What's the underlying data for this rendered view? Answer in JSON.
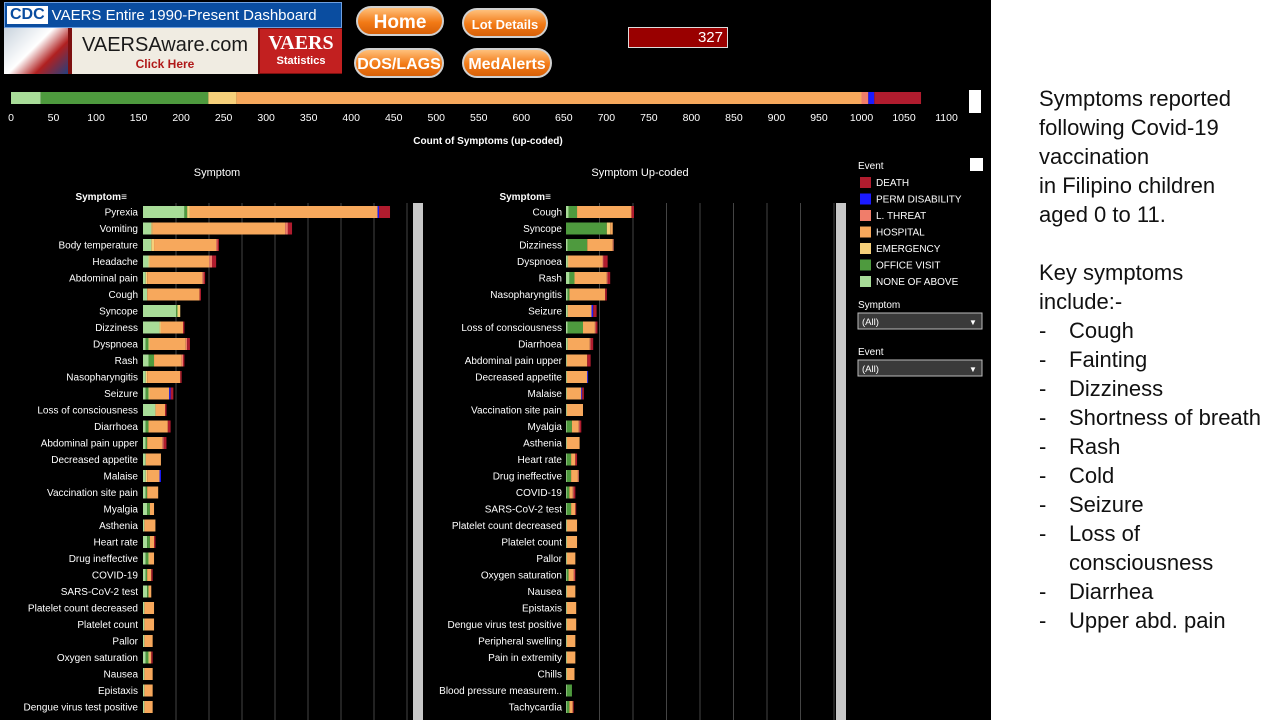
{
  "header": {
    "cdc_logo": "CDC",
    "title": "VAERS Entire 1990-Present Dashboard",
    "aware_link": "VAERSAware.com",
    "aware_click": "Click Here",
    "vaers_logo": "VAERS",
    "vaers_stats": "Statistics",
    "buttons": {
      "home": "Home",
      "lot_details": "Lot Details",
      "dos_lags": "DOS/LAGS",
      "medalerts": "MedAlerts"
    },
    "counter": "327"
  },
  "colors": {
    "DEATH": "#b01c2e",
    "PERM DISABILITY": "#1a1aff",
    "L. THREAT": "#f07d6a",
    "HOSPITAL": "#f7a85c",
    "EMERGENCY": "#f6d07a",
    "OFFICE VISIT": "#4e9a3e",
    "NONE OF ABOVE": "#a8dc98"
  },
  "chart_data": [
    {
      "type": "bar",
      "orientation": "horizontal-stacked",
      "xlabel": "Count of Symptoms (up-coded)",
      "x_ticks": [
        0,
        50,
        100,
        150,
        200,
        250,
        300,
        350,
        400,
        450,
        500,
        550,
        600,
        650,
        700,
        750,
        800,
        850,
        900,
        950,
        1000,
        1050,
        1100
      ],
      "series": [
        {
          "name": "NONE OF ABOVE",
          "values": [
            35
          ]
        },
        {
          "name": "OFFICE VISIT",
          "values": [
            197
          ]
        },
        {
          "name": "EMERGENCY",
          "values": [
            33
          ]
        },
        {
          "name": "HOSPITAL",
          "values": [
            735
          ]
        },
        {
          "name": "L. THREAT",
          "values": 8
        },
        {
          "name": "PERM DISABILITY",
          "values": [
            7
          ]
        },
        {
          "name": "DEATH",
          "values": [
            55
          ]
        }
      ]
    },
    {
      "type": "bar",
      "orientation": "horizontal-stacked",
      "title": "Symptom",
      "ylabel": "Symptom",
      "categories": [
        "Pyrexia",
        "Vomiting",
        "Body temperature",
        "Headache",
        "Abdominal pain",
        "Cough",
        "Syncope",
        "Dizziness",
        "Dyspnoea",
        "Rash",
        "Nasopharyngitis",
        "Seizure",
        "Loss of consciousness",
        "Diarrhoea",
        "Abdominal pain upper",
        "Decreased appetite",
        "Malaise",
        "Vaccination site pain",
        "Myalgia",
        "Asthenia",
        "Heart rate",
        "Drug ineffective",
        "COVID-19",
        "SARS-CoV-2 test",
        "Platelet count decreased",
        "Platelet count",
        "Pallor",
        "Oxygen saturation",
        "Nausea",
        "Epistaxis",
        "Dengue virus test positive"
      ],
      "series": [
        {
          "name": "NONE OF ABOVE",
          "values": [
            30,
            6,
            6,
            4,
            2,
            3,
            24,
            12,
            2,
            4,
            2,
            2,
            9,
            2,
            2,
            2,
            2,
            2,
            3,
            1,
            3,
            2,
            2,
            3,
            1,
            1,
            1,
            2,
            1,
            1,
            1
          ]
        },
        {
          "name": "OFFICE VISIT",
          "values": [
            2,
            0,
            0,
            0,
            0,
            0,
            1,
            0,
            2,
            4,
            0,
            2,
            0,
            2,
            1,
            0,
            0,
            1,
            2,
            0,
            2,
            2,
            1,
            1,
            0,
            0,
            0,
            2,
            0,
            0,
            0
          ]
        },
        {
          "name": "EMERGENCY",
          "values": [
            2,
            1,
            2,
            1,
            1,
            0,
            2,
            1,
            1,
            0,
            1,
            1,
            0,
            0,
            0,
            0,
            1,
            0,
            0,
            0,
            0,
            1,
            0,
            0,
            0,
            0,
            0,
            1,
            0,
            0,
            0
          ]
        },
        {
          "name": "HOSPITAL",
          "values": [
            136,
            96,
            45,
            43,
            40,
            38,
            0,
            16,
            26,
            20,
            24,
            14,
            7,
            14,
            11,
            11,
            9,
            8,
            3,
            8,
            3,
            3,
            3,
            2,
            7,
            7,
            6,
            1,
            6,
            6,
            6
          ]
        },
        {
          "name": "L. THREAT",
          "values": [
            0,
            2,
            1,
            2,
            1,
            0,
            0,
            0,
            1,
            1,
            0,
            0,
            0,
            0,
            1,
            0,
            0,
            0,
            0,
            0,
            0,
            0,
            0,
            0,
            0,
            0,
            0,
            0,
            0,
            0,
            0
          ]
        },
        {
          "name": "PERM DISABILITY",
          "values": [
            1,
            0,
            0,
            0,
            0,
            0,
            0,
            0,
            0,
            0,
            0,
            1,
            0,
            0,
            0,
            0,
            1,
            0,
            0,
            0,
            0,
            0,
            0,
            0,
            0,
            0,
            0,
            0,
            0,
            0,
            0
          ]
        },
        {
          "name": "DEATH",
          "values": [
            8,
            3,
            1,
            3,
            1,
            1,
            0,
            1,
            2,
            1,
            1,
            2,
            1,
            2,
            2,
            0,
            0,
            0,
            0,
            0,
            1,
            0,
            1,
            0,
            0,
            0,
            0,
            1,
            0,
            0,
            0
          ]
        }
      ]
    },
    {
      "type": "bar",
      "orientation": "horizontal-stacked",
      "title": "Symptom Up-coded",
      "ylabel": "Symptom",
      "categories": [
        "Cough",
        "Syncope",
        "Dizziness",
        "Dyspnoea",
        "Rash",
        "Nasopharyngitis",
        "Seizure",
        "Loss of consciousness",
        "Diarrhoea",
        "Abdominal pain upper",
        "Decreased appetite",
        "Malaise",
        "Vaccination site pain",
        "Myalgia",
        "Asthenia",
        "Heart rate",
        "Drug ineffective",
        "COVID-19",
        "SARS-CoV-2 test",
        "Platelet count decreased",
        "Platelet count",
        "Pallor",
        "Oxygen saturation",
        "Nausea",
        "Epistaxis",
        "Dengue virus test positive",
        "Peripheral swelling",
        "Pain in extremity",
        "Chills",
        "Blood pressure measurem..",
        "Tachycardia"
      ],
      "series": [
        {
          "name": "NONE OF ABOVE",
          "values": [
            3,
            0,
            2,
            2,
            4,
            2,
            2,
            2,
            2,
            1,
            1,
            1,
            1,
            1,
            1,
            1,
            1,
            1,
            1,
            1,
            1,
            1,
            1,
            1,
            1,
            1,
            1,
            1,
            1,
            1,
            1
          ]
        },
        {
          "name": "OFFICE VISIT",
          "values": [
            10,
            48,
            23,
            0,
            6,
            2,
            0,
            18,
            0,
            0,
            0,
            0,
            0,
            6,
            0,
            5,
            5,
            3,
            5,
            0,
            0,
            0,
            2,
            0,
            0,
            0,
            0,
            0,
            0,
            6,
            3
          ]
        },
        {
          "name": "EMERGENCY",
          "values": [
            0,
            4,
            0,
            1,
            0,
            0,
            0,
            0,
            0,
            0,
            0,
            0,
            0,
            0,
            0,
            0,
            0,
            0,
            0,
            0,
            0,
            0,
            0,
            0,
            0,
            0,
            0,
            0,
            0,
            0,
            0
          ]
        },
        {
          "name": "HOSPITAL",
          "values": [
            64,
            3,
            30,
            40,
            38,
            42,
            28,
            14,
            26,
            24,
            24,
            17,
            19,
            8,
            15,
            5,
            8,
            4,
            5,
            12,
            12,
            10,
            6,
            10,
            11,
            11,
            10,
            10,
            9,
            0,
            4
          ]
        },
        {
          "name": "L. THREAT",
          "values": [
            0,
            0,
            1,
            1,
            1,
            0,
            0,
            1,
            1,
            0,
            0,
            0,
            0,
            1,
            0,
            0,
            1,
            1,
            0,
            0,
            0,
            0,
            1,
            0,
            0,
            0,
            0,
            0,
            0,
            0,
            0
          ]
        },
        {
          "name": "PERM DISABILITY",
          "values": [
            0,
            0,
            0,
            0,
            0,
            0,
            2,
            0,
            0,
            0,
            1,
            1,
            0,
            0,
            0,
            0,
            0,
            0,
            0,
            0,
            0,
            0,
            0,
            0,
            0,
            0,
            0,
            0,
            0,
            0,
            0
          ]
        },
        {
          "name": "DEATH",
          "values": [
            3,
            0,
            0,
            5,
            3,
            2,
            4,
            2,
            3,
            4,
            0,
            2,
            0,
            2,
            0,
            2,
            0,
            2,
            1,
            0,
            0,
            0,
            1,
            0,
            0,
            0,
            0,
            0,
            0,
            0,
            1
          ]
        }
      ]
    }
  ],
  "legend": {
    "title": "Event",
    "items": [
      "DEATH",
      "PERM DISABILITY",
      "L. THREAT",
      "HOSPITAL",
      "EMERGENCY",
      "OFFICE VISIT",
      "NONE OF ABOVE"
    ]
  },
  "filters": [
    {
      "label": "Symptom",
      "value": "(All)"
    },
    {
      "label": "Event",
      "value": "(All)"
    }
  ],
  "notes": {
    "intro": [
      "Symptoms reported",
      "following Covid-19",
      "vaccination",
      "in Filipino children",
      "aged 0 to 11."
    ],
    "key_title": [
      "Key symptoms",
      "include:-"
    ],
    "items": [
      "Cough",
      "Fainting",
      "Dizziness",
      "Shortness of breath",
      "Rash",
      "Cold",
      "Seizure",
      "Loss of consciousness",
      "Diarrhea",
      "Upper abd. pain"
    ]
  }
}
